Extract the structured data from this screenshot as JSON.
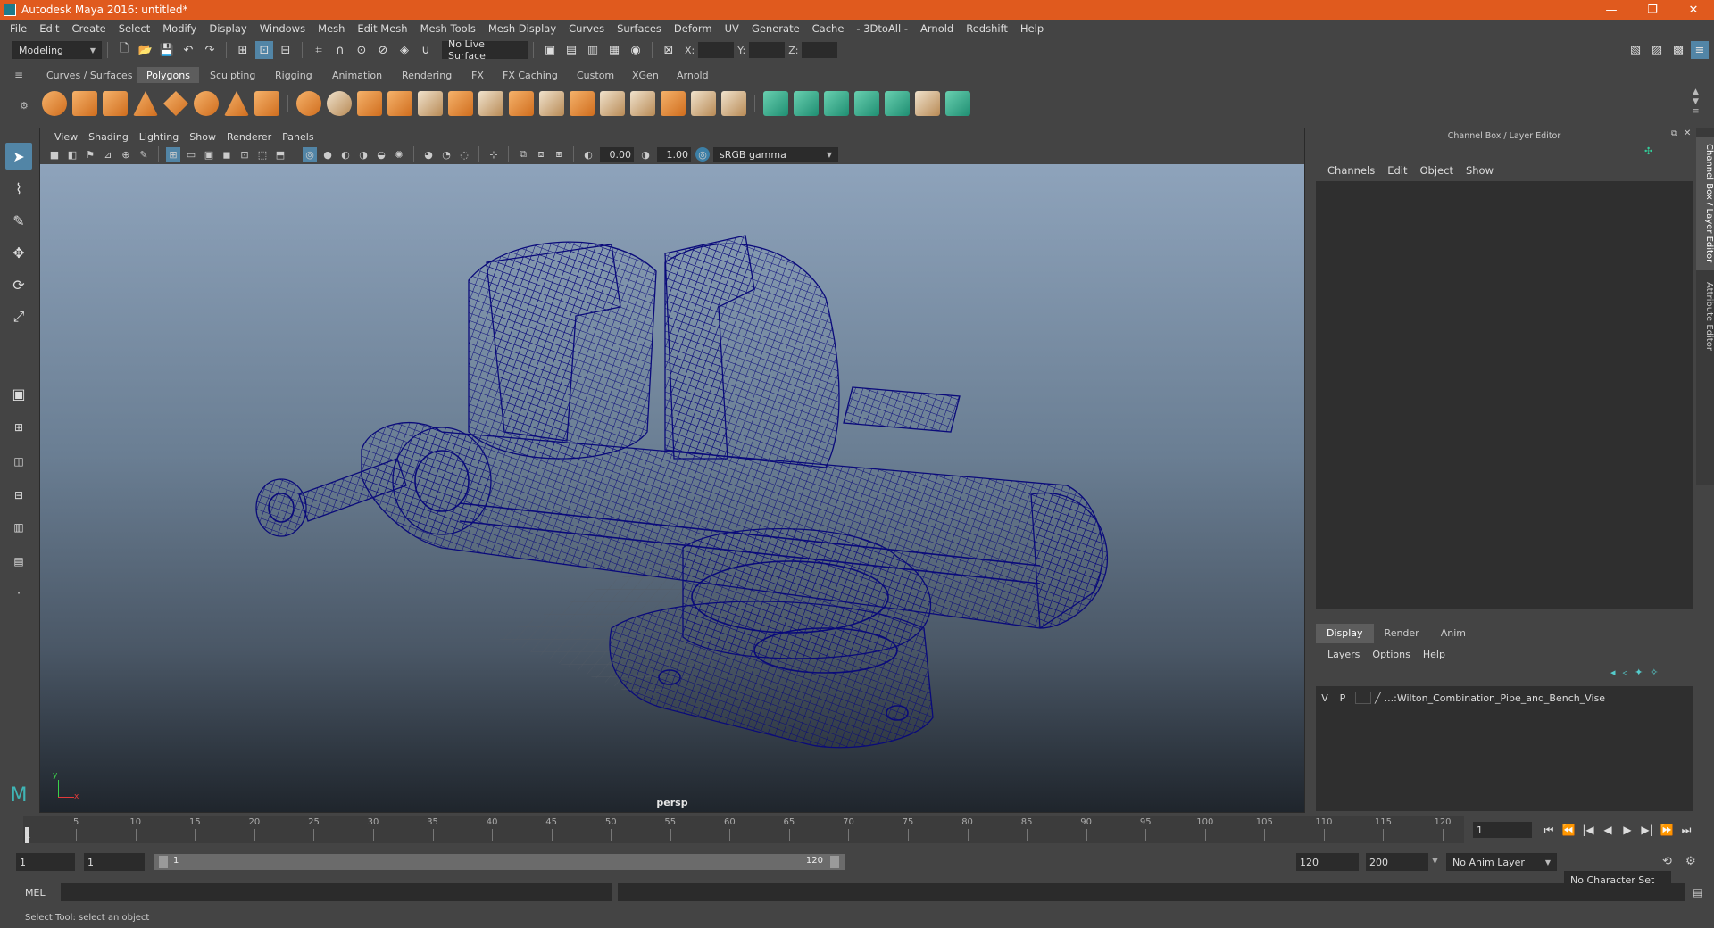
{
  "window": {
    "title": "Autodesk Maya 2016: untitled*",
    "controls": [
      "—",
      "❐",
      "✕"
    ]
  },
  "menubar": [
    "File",
    "Edit",
    "Create",
    "Select",
    "Modify",
    "Display",
    "Windows",
    "Mesh",
    "Edit Mesh",
    "Mesh Tools",
    "Mesh Display",
    "Curves",
    "Surfaces",
    "Deform",
    "UV",
    "Generate",
    "Cache",
    "- 3DtoAll -",
    "Arnold",
    "Redshift",
    "Help"
  ],
  "statusline": {
    "menuset": "Modeling",
    "live_surface": "No Live Surface",
    "x_label": "X:",
    "y_label": "Y:",
    "z_label": "Z:"
  },
  "shelf": {
    "tabs": [
      "Curves / Surfaces",
      "Polygons",
      "Sculpting",
      "Rigging",
      "Animation",
      "Rendering",
      "FX",
      "FX Caching",
      "Custom",
      "XGen",
      "Arnold"
    ],
    "active_tab": "Polygons"
  },
  "viewport": {
    "menu": [
      "View",
      "Shading",
      "Lighting",
      "Show",
      "Renderer",
      "Panels"
    ],
    "exposure": "0.00",
    "gamma": "1.00",
    "color_space": "sRGB gamma",
    "camera": "persp",
    "axis_x": "x",
    "axis_y": "y"
  },
  "channelbox": {
    "title": "Channel Box / Layer Editor",
    "menu": [
      "Channels",
      "Edit",
      "Object",
      "Show"
    ]
  },
  "layer_editor": {
    "tabs": [
      "Display",
      "Render",
      "Anim"
    ],
    "active_tab": "Display",
    "menu": [
      "Layers",
      "Options",
      "Help"
    ],
    "layers": [
      {
        "v": "V",
        "p": "P",
        "name": "...:Wilton_Combination_Pipe_and_Bench_Vise"
      }
    ]
  },
  "side_tabs": [
    "Channel Box / Layer Editor",
    "Attribute Editor"
  ],
  "timeline": {
    "ticks": [
      "1",
      "5",
      "10",
      "15",
      "20",
      "25",
      "30",
      "35",
      "40",
      "45",
      "50",
      "55",
      "60",
      "65",
      "70",
      "75",
      "80",
      "85",
      "90",
      "95",
      "100",
      "105",
      "110",
      "115",
      "120"
    ],
    "current_frame": "1",
    "playback_controls": [
      "⏮",
      "⏪",
      "|◀",
      "◀",
      "▶",
      "▶|",
      "⏩",
      "⏭"
    ]
  },
  "range": {
    "start": "1",
    "playback_start": "1",
    "slider_start": "1",
    "slider_end": "120",
    "playback_end": "120",
    "end": "200",
    "anim_layer": "No Anim Layer",
    "character_set": "No Character Set"
  },
  "commandline": {
    "label": "MEL"
  },
  "helpline": {
    "text": "Select Tool: select an object"
  }
}
